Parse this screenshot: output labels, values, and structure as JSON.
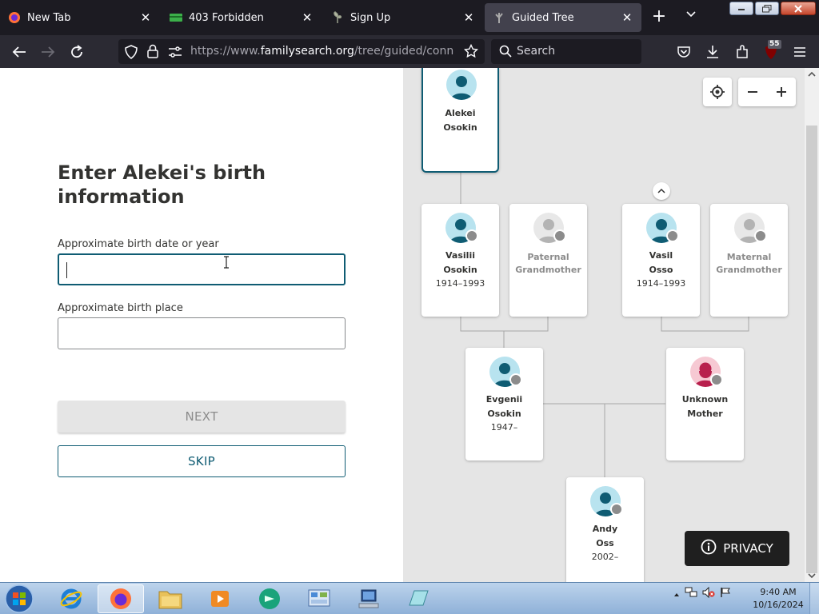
{
  "browser": {
    "tabs": [
      {
        "title": "New Tab",
        "favicon": "firefox-icon"
      },
      {
        "title": "403 Forbidden",
        "favicon": "card-icon"
      },
      {
        "title": "Sign Up",
        "favicon": "leaf-icon"
      },
      {
        "title": "Guided Tree",
        "favicon": "tree-icon",
        "active": true
      }
    ],
    "url_prefix": "https://www.",
    "url_domain": "familysearch.org",
    "url_path": "/tree/guided/connect-to-",
    "search_placeholder": "Search",
    "extension_badge": "55"
  },
  "form": {
    "heading": "Enter Alekei's birth information",
    "birth_date_label": "Approximate birth date or year",
    "birth_date_value": "",
    "birth_place_label": "Approximate birth place",
    "birth_place_value": "",
    "next_label": "NEXT",
    "skip_label": "SKIP"
  },
  "tree": {
    "focus": {
      "first": "Alekei",
      "last": "Osokin",
      "gender": "male"
    },
    "father": {
      "first": "Vasilii",
      "last": "Osokin",
      "dates": "1914–1993",
      "gender": "male"
    },
    "paternal_grandmother": {
      "line1": "Paternal",
      "line2": "Grandmother",
      "gender": "unknown"
    },
    "maternal_grandfather": {
      "first": "Vasil",
      "last": "Osso",
      "dates": "1914–1993",
      "gender": "male"
    },
    "maternal_grandmother": {
      "line1": "Maternal",
      "line2": "Grandmother",
      "gender": "unknown"
    },
    "parent_father": {
      "first": "Evgenii",
      "last": "Osokin",
      "dates": "1947–",
      "gender": "male"
    },
    "parent_mother": {
      "first": "Unknown",
      "last": "Mother",
      "gender": "female"
    },
    "child": {
      "first": "Andy",
      "last": "Oss",
      "dates": "2002–",
      "gender": "male"
    },
    "privacy_label": "PRIVACY"
  },
  "taskbar": {
    "time": "9:40 AM",
    "date": "10/16/2024"
  }
}
